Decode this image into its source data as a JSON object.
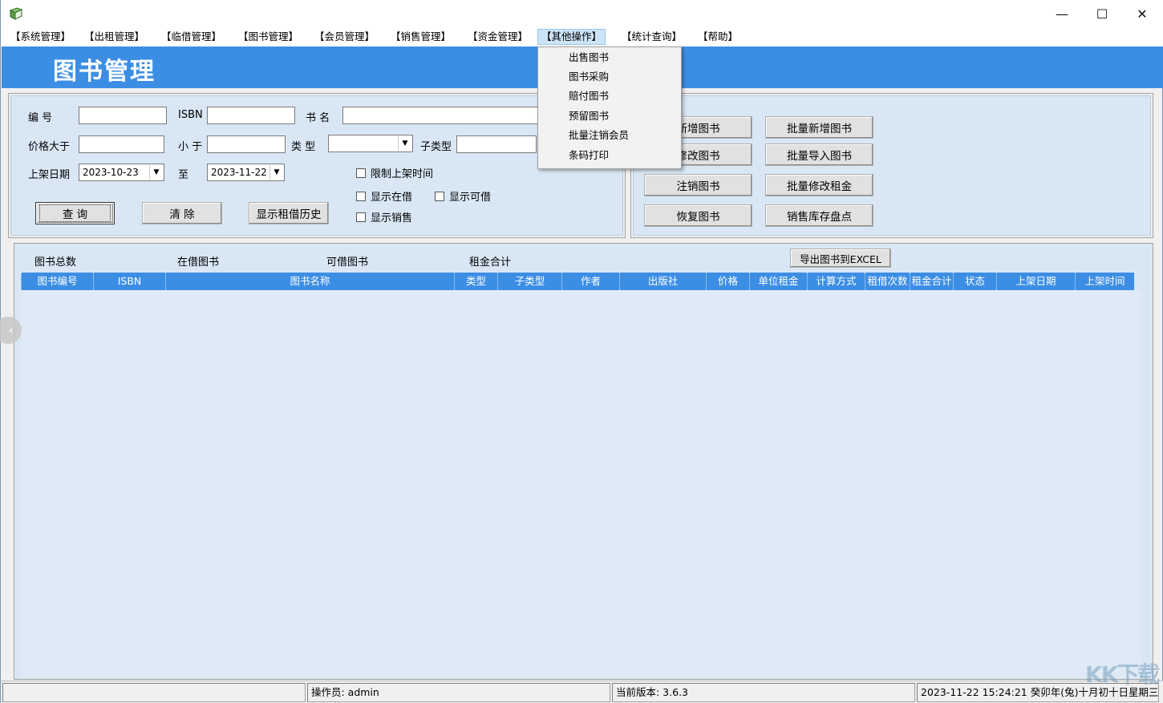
{
  "titlebar": {
    "minimize": "—",
    "maximize": "☐",
    "close": "✕"
  },
  "menubar": {
    "items": [
      {
        "label": "【系统管理】"
      },
      {
        "label": "【出租管理】"
      },
      {
        "label": "【临借管理】"
      },
      {
        "label": "【图书管理】"
      },
      {
        "label": "【会员管理】"
      },
      {
        "label": "【销售管理】"
      },
      {
        "label": "【资金管理】"
      },
      {
        "label": "【其他操作】"
      },
      {
        "label": "【统计查询】"
      },
      {
        "label": "【帮助】"
      }
    ],
    "active_index": 7
  },
  "header": {
    "title": "图书管理"
  },
  "dropdown": {
    "items": [
      "出售图书",
      "图书采购",
      "赔付图书",
      "预留图书",
      "批量注销会员",
      "条码打印"
    ]
  },
  "search": {
    "labels": {
      "id": "编  号",
      "isbn": "ISBN",
      "title": "书  名",
      "price_min": "价格大于",
      "price_max": "小  于",
      "type": "类  型",
      "subtype": "子类型",
      "date_from": "上架日期",
      "date_to": "至"
    },
    "values": {
      "id": "",
      "isbn": "",
      "title": "",
      "price_min": "",
      "price_max": "",
      "type": "",
      "subtype": "",
      "date_from": "2023-10-23",
      "date_to": "2023-11-22"
    },
    "checkboxes": {
      "limit_shelf_time": "限制上架时间",
      "show_on_loan": "显示在借",
      "show_available": "显示可借",
      "show_sold": "显示销售"
    },
    "buttons": {
      "query": "查 询",
      "clear": "清 除",
      "history": "显示租借历史"
    }
  },
  "ops": {
    "add_book": "新增图书",
    "edit_book": "修改图书",
    "cancel_book": "注销图书",
    "restore_book": "恢复图书",
    "batch_add": "批量新增图书",
    "batch_import": "批量导入图书",
    "batch_rent": "批量修改租金",
    "stock_check": "销售库存盘点"
  },
  "stats": {
    "total": "图书总数",
    "on_loan": "在借图书",
    "available": "可借图书",
    "rent_total": "租金合计",
    "export_button": "导出图书到EXCEL"
  },
  "grid": {
    "columns": [
      "图书编号",
      "ISBN",
      "图书名称",
      "类型",
      "子类型",
      "作者",
      "出版社",
      "价格",
      "单位租金",
      "计算方式",
      "租借次数",
      "租金合计",
      "状态",
      "上架日期",
      "上架时间"
    ]
  },
  "statusbar": {
    "cell0": "",
    "operator": "操作员: admin",
    "version": "当前版本: 3.6.3",
    "datetime": "2023-11-22 15:24:21 癸卯年(兔)十月初十日星期三"
  },
  "watermark": "KK下载",
  "colors": {
    "accent": "#3c8ee4",
    "panel": "#d9e7f5"
  }
}
